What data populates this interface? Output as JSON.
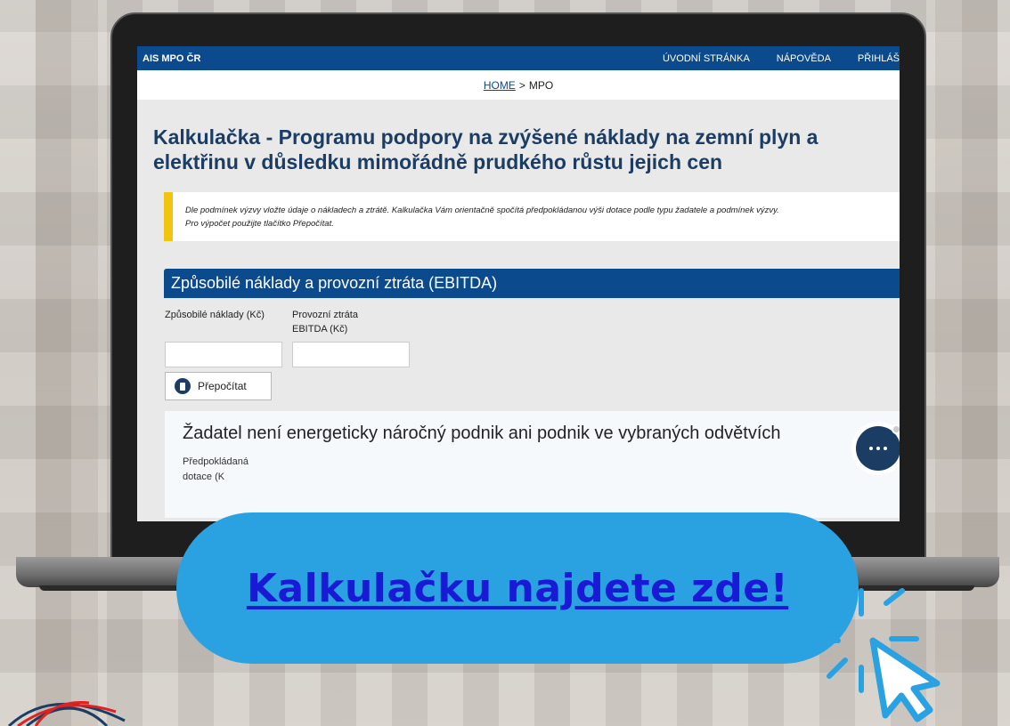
{
  "app": {
    "brand": "AIS MPO ČR",
    "nav": [
      "ÚVODNÍ STRÁNKA",
      "NÁPOVĚDA",
      "PŘIHLÁŠ"
    ]
  },
  "breadcrumb": {
    "home": "HOME",
    "separator": ">",
    "current": "MPO"
  },
  "page": {
    "title": "Kalkulačka - Programu podpory na zvýšené náklady na zemní plyn a elektřinu v důsledku mimořádně prudkého růstu jejich cen"
  },
  "notice": {
    "line1": "Dle podmínek výzvy vložte údaje o nákladech a ztrátě. Kalkulačka Vám orientačně spočítá předpokládanou výši dotace podle typu žadatele a podmínek výzvy.",
    "line2": "Pro výpočet použijte tlačítko Přepočítat."
  },
  "section": {
    "title": "Způsobilé náklady a provozní ztráta (EBITDA)"
  },
  "fields": {
    "costs_label": "Způsobilé náklady (Kč)",
    "costs_value": "",
    "loss_label": "Provozní ztráta EBITDA (Kč)",
    "loss_value": ""
  },
  "recalc_button": {
    "label": "Přepočítat",
    "icon": "calculator-icon"
  },
  "card": {
    "title": "Žadatel není energeticky náročný podnik ani podnik ve vybraných odvětvích",
    "label": "Předpokládaná dotace (K"
  },
  "chat": {
    "icon": "chat-bubble-icon"
  },
  "cta": {
    "label": "Kalkulačku najdete zde!"
  },
  "colors": {
    "nav_blue": "#0b4a8c",
    "notice_yellow": "#f1c40f",
    "cta_blue": "#2aa2e2",
    "cta_text": "#1a1ad6"
  }
}
